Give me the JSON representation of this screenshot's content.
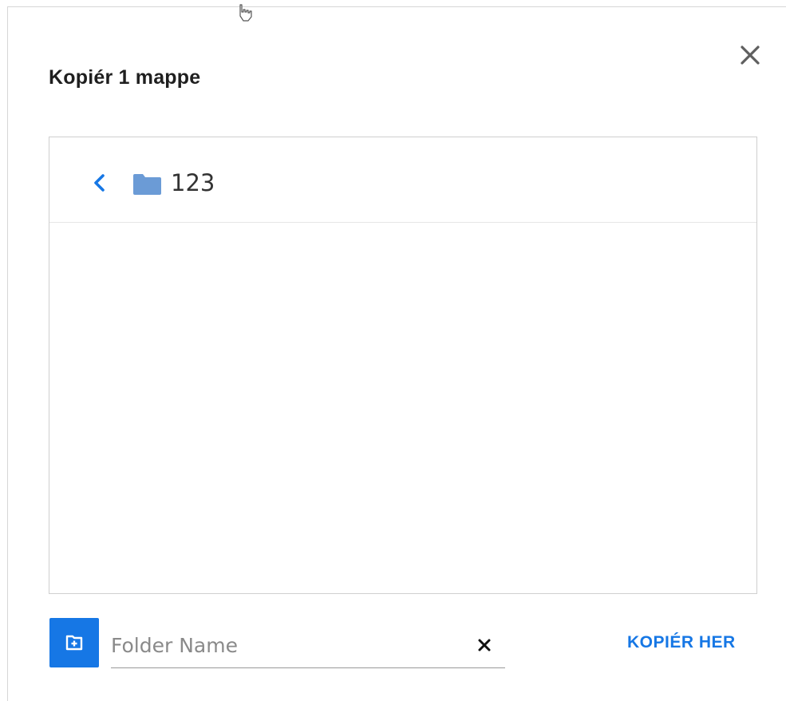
{
  "dialog": {
    "title": "Kopiér 1 mappe"
  },
  "browser": {
    "current_folder": "123"
  },
  "footer": {
    "folder_name_placeholder": "Folder Name",
    "folder_name_value": "",
    "copy_here_label": "KOPIÉR HER"
  },
  "icons": {
    "close": "close-icon",
    "back": "chevron-left-icon",
    "folder": "folder-icon",
    "new_folder": "folder-plus-icon",
    "clear": "clear-icon",
    "cursor": "hand-cursor-icon"
  },
  "colors": {
    "accent": "#1677e5",
    "folder": "#6b9bd6",
    "title": "#1f1f1f",
    "border": "#cfcfcf"
  }
}
